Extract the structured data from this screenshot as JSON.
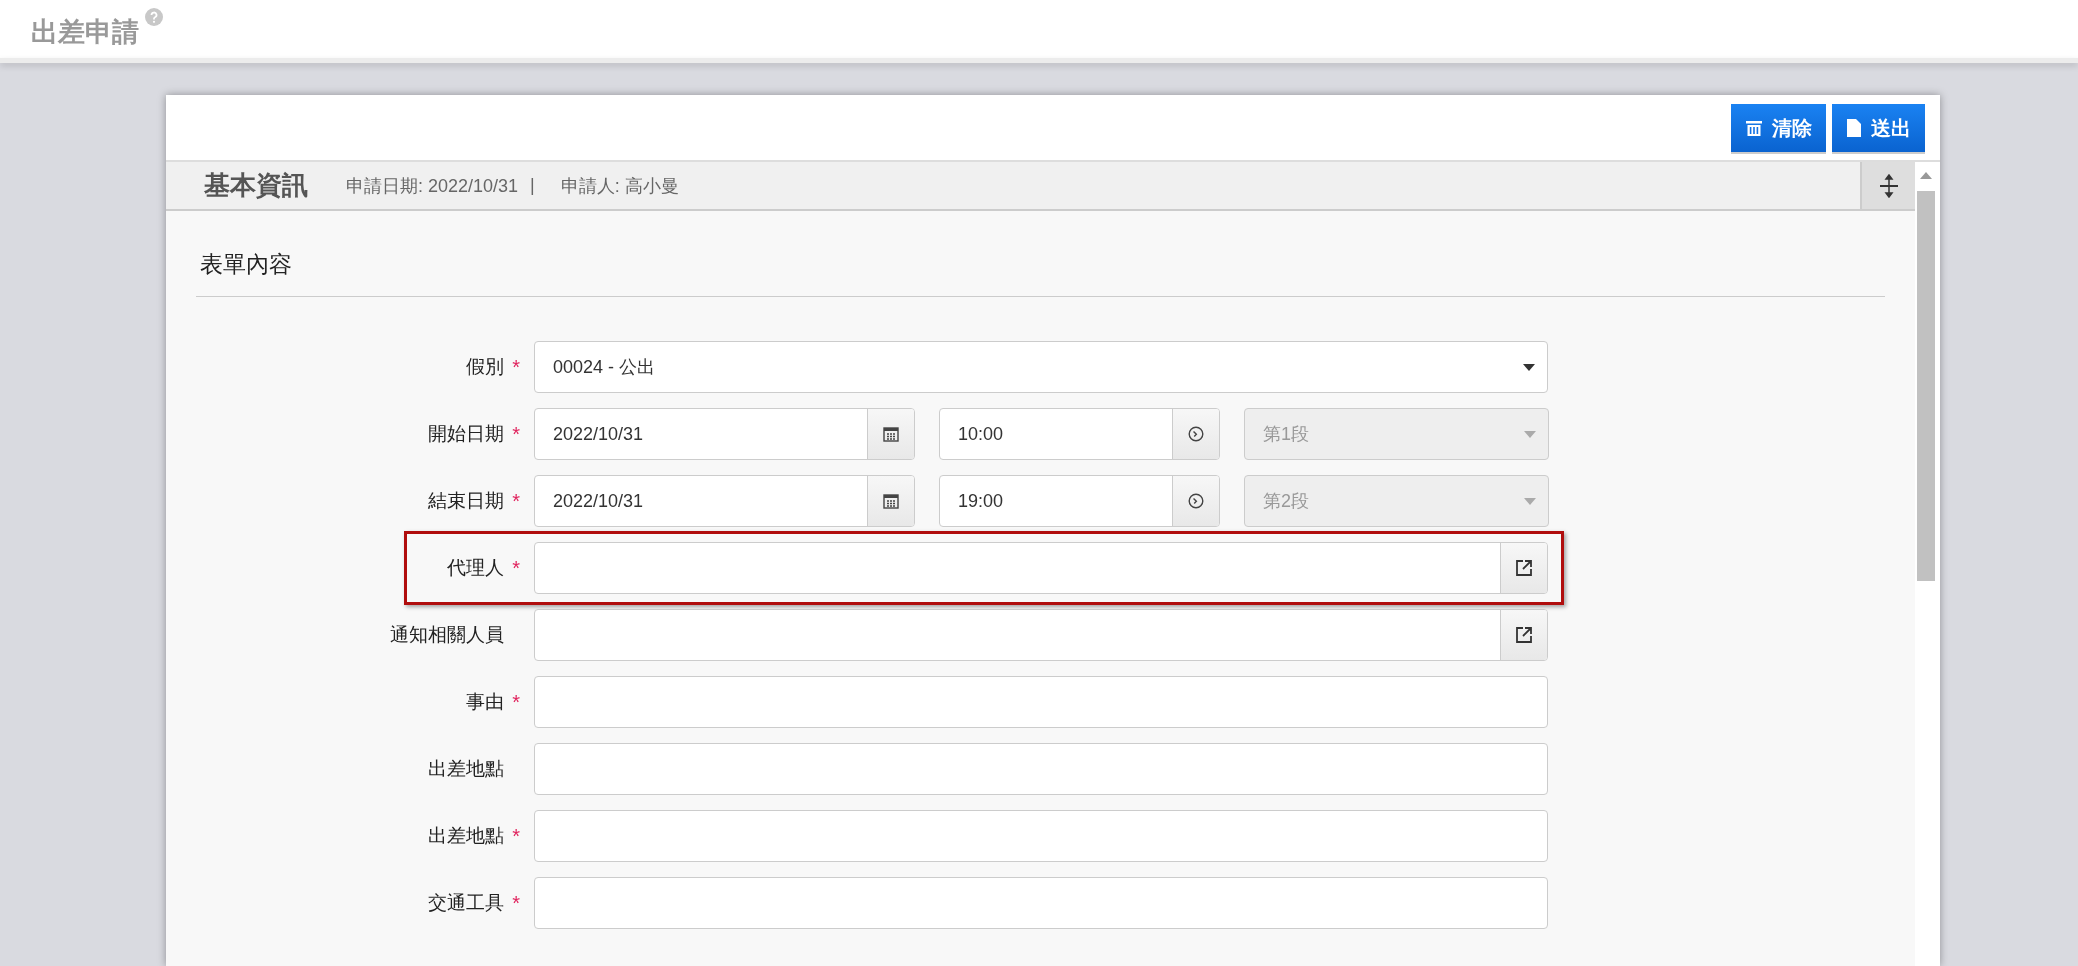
{
  "page_title": "出差申請",
  "toolbar": {
    "buttons": [
      {
        "label": "清除",
        "kind": "clear"
      },
      {
        "label": "送出",
        "kind": "submit"
      }
    ]
  },
  "section": {
    "title": "基本資訊",
    "apply_date": "申請日期: 2022/10/31",
    "separator": "|",
    "applicant": "申請人: 高小曼"
  },
  "form": {
    "title": "表單內容",
    "rows": [
      {
        "kind": "select",
        "label": "假別",
        "required_mark": "*",
        "value": "00024 - 公出"
      },
      {
        "kind": "datetime",
        "label": "開始日期",
        "required_mark": "*",
        "date": "2022/10/31",
        "time": "10:00",
        "period": {
          "value": "第1段",
          "disabled": true
        }
      },
      {
        "kind": "datetime",
        "label": "結束日期",
        "required_mark": "*",
        "date": "2022/10/31",
        "time": "19:00",
        "period": {
          "value": "第2段",
          "disabled": true
        }
      },
      {
        "kind": "lookup",
        "label": "代理人",
        "required_mark": "*",
        "highlighted": true
      },
      {
        "kind": "lookup",
        "label": "通知相關人員"
      },
      {
        "kind": "text",
        "label": "事由",
        "required_mark": "*"
      },
      {
        "kind": "text",
        "label": "出差地點"
      },
      {
        "kind": "text",
        "label": "出差地點",
        "required_mark": "*"
      },
      {
        "kind": "text",
        "label": "交通工具",
        "required_mark": "*"
      }
    ]
  }
}
